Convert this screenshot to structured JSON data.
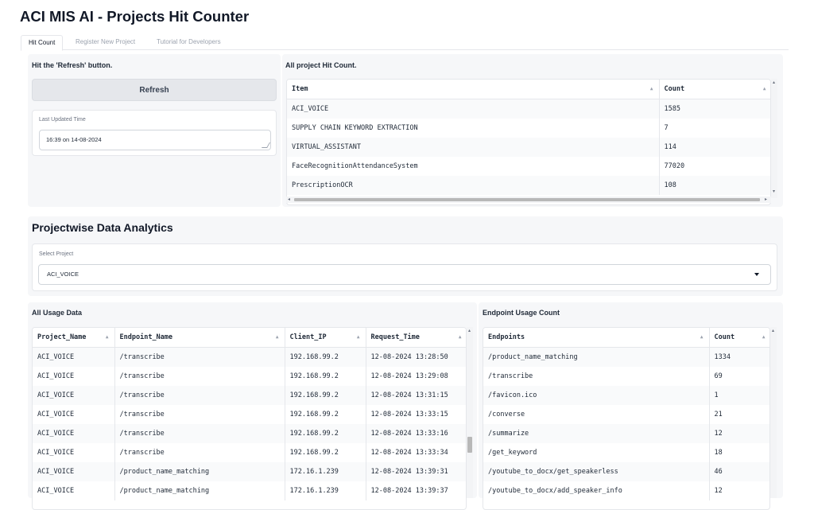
{
  "app": {
    "title": "ACI MIS AI - Projects Hit Counter"
  },
  "tabs": [
    {
      "label": "Hit Count",
      "active": true
    },
    {
      "label": "Register New Project",
      "active": false
    },
    {
      "label": "Tutorial for Developers",
      "active": false
    }
  ],
  "hit_panel": {
    "label": "Hit the 'Refresh' button.",
    "refresh_label": "Refresh",
    "last_updated_label": "Last Updated Time",
    "last_updated_value": "16:39 on 14-08-2024"
  },
  "hit_table": {
    "label": "All project Hit Count.",
    "columns": [
      "Item",
      "Count"
    ],
    "rows": [
      [
        "ACI_VOICE",
        "1585"
      ],
      [
        "SUPPLY CHAIN KEYWORD EXTRACTION",
        "7"
      ],
      [
        "VIRTUAL_ASSISTANT",
        "114"
      ],
      [
        "FaceRecognitionAttendanceSystem",
        "77020"
      ],
      [
        "PrescriptionOCR",
        "108"
      ]
    ]
  },
  "analytics": {
    "title": "Projectwise Data Analytics",
    "select_label": "Select Project",
    "selected_project": "ACI_VOICE"
  },
  "usage_table": {
    "label": "All Usage Data",
    "columns": [
      "Project_Name",
      "Endpoint_Name",
      "Client_IP",
      "Request_Time"
    ],
    "rows": [
      [
        "ACI_VOICE",
        "/transcribe",
        "192.168.99.2",
        "12-08-2024 13:28:50"
      ],
      [
        "ACI_VOICE",
        "/transcribe",
        "192.168.99.2",
        "12-08-2024 13:29:08"
      ],
      [
        "ACI_VOICE",
        "/transcribe",
        "192.168.99.2",
        "12-08-2024 13:31:15"
      ],
      [
        "ACI_VOICE",
        "/transcribe",
        "192.168.99.2",
        "12-08-2024 13:33:15"
      ],
      [
        "ACI_VOICE",
        "/transcribe",
        "192.168.99.2",
        "12-08-2024 13:33:16"
      ],
      [
        "ACI_VOICE",
        "/transcribe",
        "192.168.99.2",
        "12-08-2024 13:33:34"
      ],
      [
        "ACI_VOICE",
        "/product_name_matching",
        "172.16.1.239",
        "12-08-2024 13:39:31"
      ],
      [
        "ACI_VOICE",
        "/product_name_matching",
        "172.16.1.239",
        "12-08-2024 13:39:37"
      ]
    ]
  },
  "endpoint_table": {
    "label": "Endpoint Usage Count",
    "columns": [
      "Endpoints",
      "Count"
    ],
    "rows": [
      [
        "/product_name_matching",
        "1334"
      ],
      [
        "/transcribe",
        "69"
      ],
      [
        "/favicon.ico",
        "1"
      ],
      [
        "/converse",
        "21"
      ],
      [
        "/summarize",
        "12"
      ],
      [
        "/get_keyword",
        "18"
      ],
      [
        "/youtube_to_docx/get_speakerless",
        "46"
      ],
      [
        "/youtube_to_docx/add_speaker_info",
        "12"
      ]
    ]
  },
  "icons": {
    "sort": "sort-arrow-icon",
    "dropdown": "chevron-down-icon",
    "resize": "resize-handle-icon"
  }
}
